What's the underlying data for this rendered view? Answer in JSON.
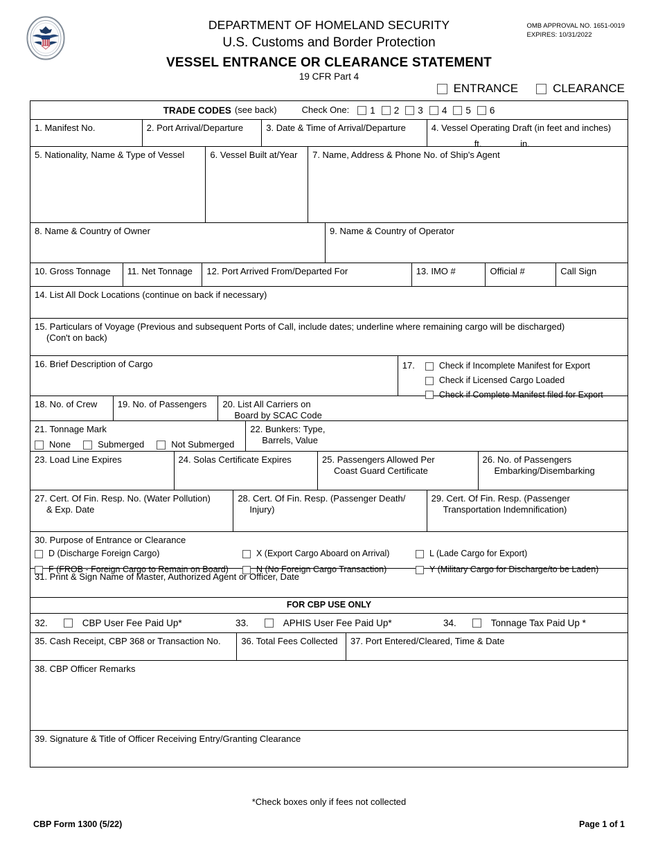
{
  "header": {
    "agency_line1": "DEPARTMENT OF HOMELAND SECURITY",
    "agency_line2": "U.S. Customs and Border Protection",
    "omb_approval": "OMB APPROVAL NO. 1651-0019",
    "omb_expires": "EXPIRES: 10/31/2022",
    "form_title": "VESSEL ENTRANCE OR CLEARANCE STATEMENT",
    "form_subtitle": "19 CFR Part 4",
    "seal_icon": "cbp-seal-icon",
    "entrance_label": "ENTRANCE",
    "clearance_label": "CLEARANCE"
  },
  "trade": {
    "title": "TRADE CODES",
    "see_back": "(see back)",
    "check_one": "Check One:",
    "codes": [
      "1",
      "2",
      "3",
      "4",
      "5",
      "6"
    ]
  },
  "fields": {
    "f1": "1. Manifest No.",
    "f2": "2. Port Arrival/Departure",
    "f3": "3. Date & Time of Arrival/Departure",
    "f4": "4. Vessel Operating Draft (in feet and inches)",
    "f4_ft": "ft.",
    "f4_in": "in.",
    "f5": "5. Nationality, Name & Type of Vessel",
    "f6": "6. Vessel Built at/Year",
    "f7": "7. Name, Address & Phone No. of Ship's Agent",
    "f8": "8. Name & Country of Owner",
    "f9": "9. Name & Country of Operator",
    "f10": "10. Gross Tonnage",
    "f11": "11. Net Tonnage",
    "f12": "12. Port Arrived From/Departed For",
    "f13": "13. IMO #",
    "f13b": "Official #",
    "f13c": "Call Sign",
    "f14": "14. List All Dock Locations (continue on back if necessary)",
    "f15_line1": "15. Particulars of Voyage (Previous and subsequent Ports of Call, include dates; underline where remaining cargo will be discharged)",
    "f15_line2": "(Con't on back)",
    "f16": "16. Brief Description of Cargo",
    "f17_num": "17.",
    "f17_opt1": "Check if Incomplete Manifest for Export",
    "f17_opt2": "Check if Licensed Cargo Loaded",
    "f17_opt3": "Check if Complete Manifest filed for Export",
    "f18": "18. No. of Crew",
    "f19": "19. No. of Passengers",
    "f20_line1": "20. List All Carriers on",
    "f20_line2": "Board by SCAC Code",
    "f21": "21. Tonnage Mark",
    "f21_opt1": "None",
    "f21_opt2": "Submerged",
    "f21_opt3": "Not Submerged",
    "f22_line1": "22. Bunkers: Type,",
    "f22_line2": "Barrels, Value",
    "f23": "23. Load Line Expires",
    "f24": "24. Solas Certificate Expires",
    "f25_line1": "25. Passengers Allowed Per",
    "f25_line2": "Coast Guard Certificate",
    "f26_line1": "26. No. of Passengers",
    "f26_line2": "Embarking/Disembarking",
    "f27_line1": "27. Cert. Of Fin. Resp. No. (Water Pollution)",
    "f27_line2": "& Exp. Date",
    "f28_line1": "28. Cert. Of Fin. Resp. (Passenger Death/",
    "f28_line2": "Injury)",
    "f29_line1": "29. Cert. Of Fin. Resp. (Passenger",
    "f29_line2": "Transportation Indemnification)",
    "f30": "30. Purpose of Entrance or Clearance",
    "f30_d": "D (Discharge Foreign Cargo)",
    "f30_f": "F (FROB - Foreign Cargo to Remain on Board)",
    "f30_x": "X (Export Cargo Aboard on Arrival)",
    "f30_n": "N (No Foreign Cargo Transaction)",
    "f30_l": "L (Lade Cargo for Export)",
    "f30_y": "Y (Military Cargo for Discharge/to be Laden)",
    "f31": "31. Print & Sign Name of Master, Authorized Agent or Officer, Date",
    "cbp_band": "FOR CBP USE ONLY",
    "f32_num": "32.",
    "f32": "CBP User Fee Paid Up*",
    "f33_num": "33.",
    "f33": "APHIS User Fee Paid Up*",
    "f34_num": "34.",
    "f34": "Tonnage Tax Paid Up *",
    "f35": "35. Cash Receipt, CBP 368 or Transaction No.",
    "f36": "36. Total Fees Collected",
    "f37": "37. Port Entered/Cleared, Time & Date",
    "f38": "38. CBP Officer Remarks",
    "f39": "39. Signature & Title of Officer Receiving Entry/Granting Clearance"
  },
  "footer": {
    "note": "*Check boxes only if fees not collected",
    "form_id": "CBP Form 1300 (5/22)",
    "page": "Page 1 of 1"
  }
}
